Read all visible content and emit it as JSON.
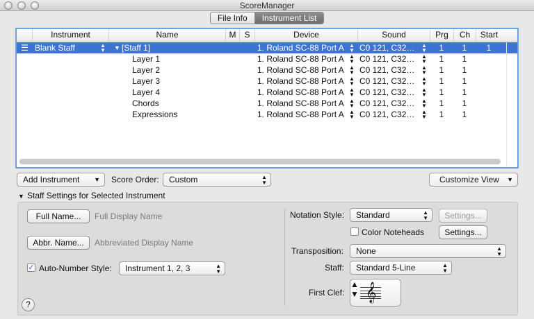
{
  "window": {
    "title": "ScoreManager"
  },
  "tabs": [
    "File Info",
    "Instrument List"
  ],
  "table": {
    "headers": [
      "Instrument",
      "Name",
      "M",
      "S",
      "Device",
      "Sound",
      "Prg",
      "Ch",
      "Start"
    ],
    "rows": [
      {
        "instrument": "Blank Staff",
        "name": "[Staff 1]",
        "device": "1. Roland SC-88 Port A",
        "sound": "C0 121, C32…",
        "prg": "1",
        "ch": "1",
        "start": "1"
      },
      {
        "instrument": "",
        "name": "Layer 1",
        "device": "1. Roland SC-88 Port A",
        "sound": "C0 121, C32…",
        "prg": "1",
        "ch": "1",
        "start": ""
      },
      {
        "instrument": "",
        "name": "Layer 2",
        "device": "1. Roland SC-88 Port A",
        "sound": "C0 121, C32…",
        "prg": "1",
        "ch": "1",
        "start": ""
      },
      {
        "instrument": "",
        "name": "Layer 3",
        "device": "1. Roland SC-88 Port A",
        "sound": "C0 121, C32…",
        "prg": "1",
        "ch": "1",
        "start": ""
      },
      {
        "instrument": "",
        "name": "Layer 4",
        "device": "1. Roland SC-88 Port A",
        "sound": "C0 121, C32…",
        "prg": "1",
        "ch": "1",
        "start": ""
      },
      {
        "instrument": "",
        "name": "Chords",
        "device": "1. Roland SC-88 Port A",
        "sound": "C0 121, C32…",
        "prg": "1",
        "ch": "1",
        "start": ""
      },
      {
        "instrument": "",
        "name": "Expressions",
        "device": "1. Roland SC-88 Port A",
        "sound": "C0 121, C32…",
        "prg": "1",
        "ch": "1",
        "start": ""
      }
    ]
  },
  "controls": {
    "add_instrument": "Add Instrument",
    "score_order_label": "Score Order:",
    "score_order_value": "Custom",
    "customize_view": "Customize View"
  },
  "staff_settings": {
    "section_title": "Staff Settings for Selected Instrument",
    "full_name_button": "Full Name...",
    "full_name_display": "Full Display Name",
    "abbr_name_button": "Abbr. Name...",
    "abbr_name_display": "Abbreviated Display Name",
    "auto_number_label": "Auto-Number Style:",
    "auto_number_checked": true,
    "auto_number_value": "Instrument 1, 2, 3",
    "notation_style_label": "Notation Style:",
    "notation_style_value": "Standard",
    "settings_disabled": "Settings...",
    "color_noteheads_label": "Color Noteheads",
    "color_noteheads_checked": false,
    "settings_enabled": "Settings...",
    "transposition_label": "Transposition:",
    "transposition_value": "None",
    "staff_label": "Staff:",
    "staff_value": "Standard 5-Line",
    "first_clef_label": "First Clef:",
    "clef_symbol": "𝄞"
  },
  "help_label": "?"
}
